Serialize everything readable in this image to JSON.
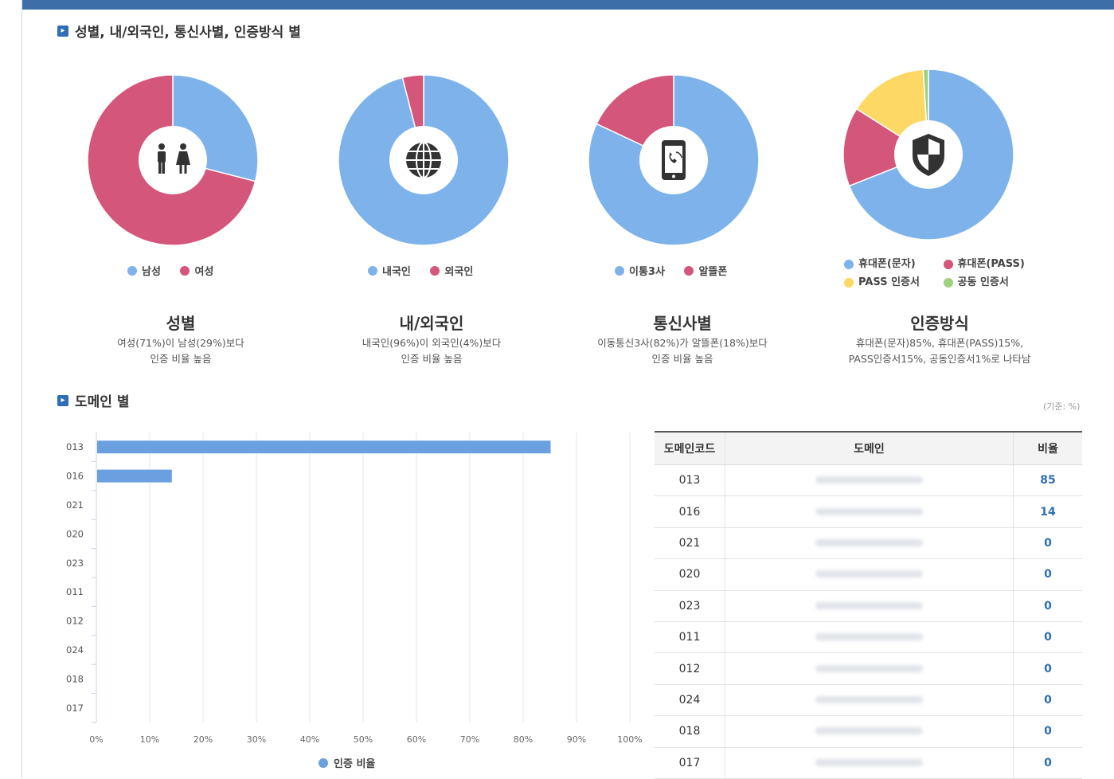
{
  "section1_title": "성별, 내/외국인, 통신사별, 인증방식 별",
  "section2_title": "도메인 별",
  "pies": [
    {
      "id": "gender",
      "icon": "gender-icon",
      "slices": [
        {
          "label": "남성",
          "value": 29,
          "color": "#7db3ea"
        },
        {
          "label": "여성",
          "value": 71,
          "color": "#d4567a"
        }
      ],
      "title": "성별",
      "desc_line1": "여성(71%)이 남성(29%)보다",
      "desc_line2": "인증 비율 높음"
    },
    {
      "id": "nationality",
      "icon": "globe-icon",
      "slices": [
        {
          "label": "내국인",
          "value": 96,
          "color": "#7db3ea"
        },
        {
          "label": "외국인",
          "value": 4,
          "color": "#d4567a"
        }
      ],
      "title": "내/외국인",
      "desc_line1": "내국인(96%)이 외국인(4%)보다",
      "desc_line2": "인증 비율 높음"
    },
    {
      "id": "carrier",
      "icon": "phone-icon",
      "slices": [
        {
          "label": "이통3사",
          "value": 82,
          "color": "#7db3ea"
        },
        {
          "label": "알뜰폰",
          "value": 18,
          "color": "#d4567a"
        }
      ],
      "title": "통신사별",
      "desc_line1": "이동통신3사(82%)가 알뜰폰(18%)보다",
      "desc_line2": "인증 비율 높음"
    },
    {
      "id": "auth",
      "icon": "shield-icon",
      "slices": [
        {
          "label": "휴대폰(문자)",
          "value": 69,
          "color": "#7db3ea"
        },
        {
          "label": "휴대폰(PASS)",
          "value": 15,
          "color": "#d4567a"
        },
        {
          "label": "PASS 인증서",
          "value": 15,
          "color": "#fdd865"
        },
        {
          "label": "공동 인증서",
          "value": 1,
          "color": "#9fd17f"
        }
      ],
      "title": "인증방식",
      "desc_line1": "휴대폰(문자)85%, 휴대폰(PASS)15%,",
      "desc_line2": "PASS인증서15%, 공동인증서1%로 나타남"
    }
  ],
  "chart_data": {
    "type": "bar",
    "orientation": "horizontal",
    "categories": [
      "013",
      "016",
      "021",
      "020",
      "023",
      "011",
      "012",
      "024",
      "018",
      "017"
    ],
    "series": [
      {
        "name": "인증 비율",
        "values": [
          85,
          14,
          0,
          0,
          0,
          0,
          0,
          0,
          0,
          0
        ],
        "color": "#6a9fe0"
      }
    ],
    "xlim": [
      0,
      100
    ],
    "xticks": [
      "0%",
      "10%",
      "20%",
      "30%",
      "40%",
      "50%",
      "60%",
      "70%",
      "80%",
      "90%",
      "100%"
    ],
    "grid": true,
    "legend": "bottom"
  },
  "unit_note": "(기준: %)",
  "table": {
    "headers": [
      "도메인코드",
      "도메인",
      "비율"
    ],
    "rows": [
      {
        "code": "013",
        "ratio": "85"
      },
      {
        "code": "016",
        "ratio": "14"
      },
      {
        "code": "021",
        "ratio": "0"
      },
      {
        "code": "020",
        "ratio": "0"
      },
      {
        "code": "023",
        "ratio": "0"
      },
      {
        "code": "011",
        "ratio": "0"
      },
      {
        "code": "012",
        "ratio": "0"
      },
      {
        "code": "024",
        "ratio": "0"
      },
      {
        "code": "018",
        "ratio": "0"
      },
      {
        "code": "017",
        "ratio": "0"
      }
    ]
  }
}
